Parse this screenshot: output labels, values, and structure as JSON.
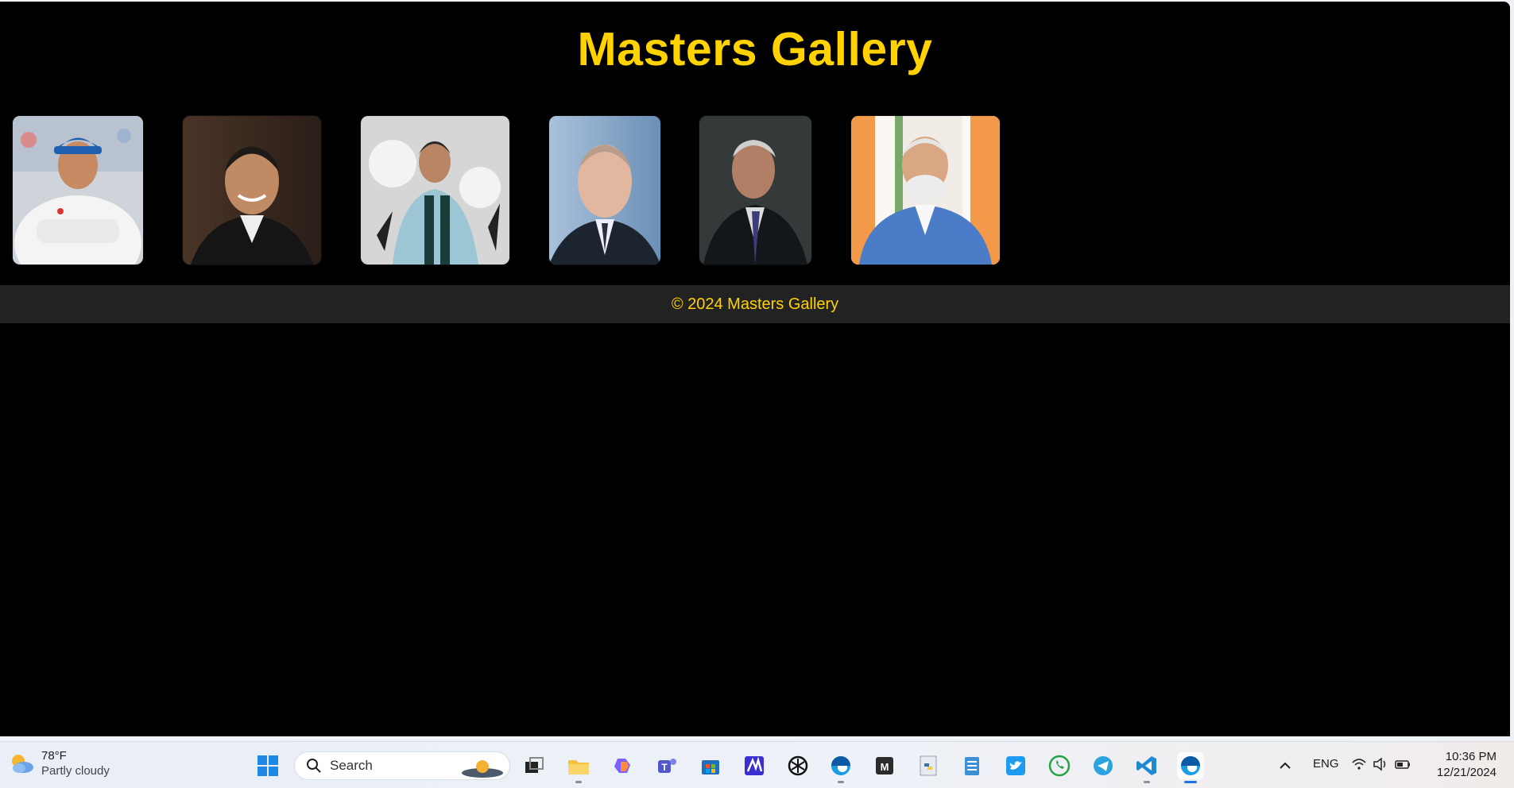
{
  "page": {
    "title": "Masters Gallery",
    "footer": "© 2024 Masters Gallery"
  },
  "gallery": {
    "photos": [
      {
        "name": "photo-cricketer",
        "bg": "#c9ccd4"
      },
      {
        "name": "photo-businessman-suit",
        "bg": "#3a2a22"
      },
      {
        "name": "photo-footballer",
        "bg": "#bdbdbd"
      },
      {
        "name": "photo-leader-suit",
        "bg": "#8fb0cf"
      },
      {
        "name": "photo-elder-suit",
        "bg": "#303635"
      },
      {
        "name": "photo-leader-flag",
        "bg": "#efe6dc"
      }
    ]
  },
  "taskbar": {
    "weather": {
      "temp": "78°F",
      "condition": "Partly cloudy"
    },
    "search_label": "Search",
    "language": "ENG",
    "time": "10:36 PM",
    "date": "12/21/2024"
  },
  "colors": {
    "accent": "#ffd200",
    "background": "#000000",
    "footer_bg": "#222222"
  }
}
